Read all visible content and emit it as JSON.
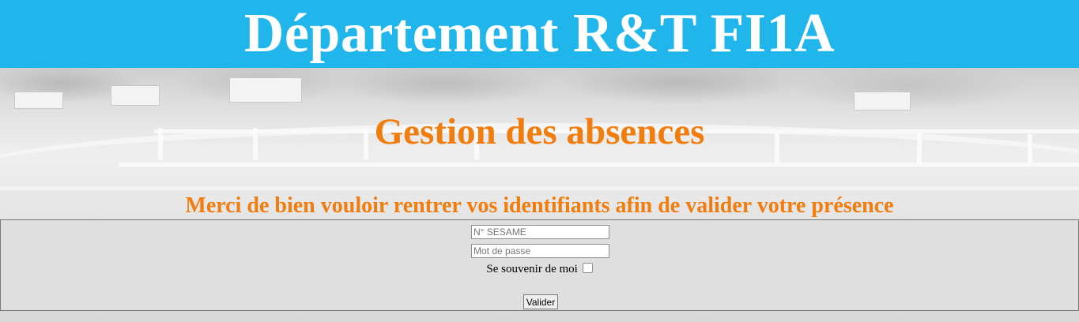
{
  "header": {
    "title": "Département R&T FI1A",
    "banner_color": "#20b5eb"
  },
  "page": {
    "subtitle": "Gestion des absences",
    "message": "Merci de bien vouloir rentrer vos identifiants afin de valider votre présence",
    "accent_color": "#f07d0e"
  },
  "login": {
    "sesame_placeholder": "N° SESAME",
    "password_placeholder": "Mot de passe",
    "remember_label": "Se souvenir de moi",
    "remember_checked": false,
    "submit_label": "Valider"
  }
}
